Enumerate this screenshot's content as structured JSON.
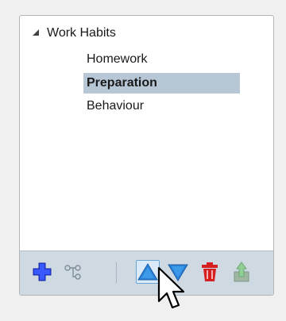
{
  "tree": {
    "root": {
      "label": "Work Habits",
      "expanded": true
    },
    "children": [
      {
        "label": "Homework",
        "selected": false
      },
      {
        "label": "Preparation",
        "selected": true
      },
      {
        "label": "Behaviour",
        "selected": false
      }
    ]
  },
  "toolbar": {
    "buttons": [
      {
        "icon": "plus-icon"
      },
      {
        "icon": "hierarchy-icon"
      },
      {
        "icon": "arrow-up-icon"
      },
      {
        "icon": "arrow-down-icon"
      },
      {
        "icon": "trash-icon"
      },
      {
        "icon": "export-icon"
      }
    ]
  },
  "colors": {
    "selection": "#b7c7d6",
    "toolbar": "#cfd9e2",
    "accent_blue": "#2f6fd6",
    "delete_red": "#d81f1f",
    "add_blue": "#2440e0"
  }
}
